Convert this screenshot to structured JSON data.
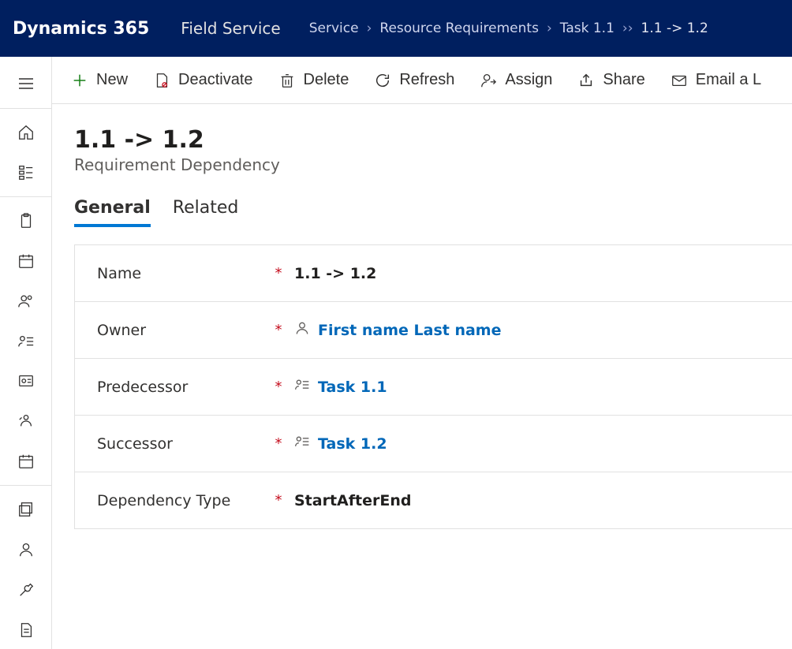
{
  "header": {
    "brand": "Dynamics 365",
    "app_title": "Field Service",
    "breadcrumb": {
      "area": "Service",
      "entity": "Resource Requirements",
      "parent": "Task 1.1",
      "current": "1.1 -> 1.2"
    }
  },
  "commands": {
    "new": "New",
    "deactivate": "Deactivate",
    "delete": "Delete",
    "refresh": "Refresh",
    "assign": "Assign",
    "share": "Share",
    "email_link": "Email a L"
  },
  "record": {
    "title": "1.1 -> 1.2",
    "subtitle": "Requirement Dependency"
  },
  "tabs": {
    "general": "General",
    "related": "Related"
  },
  "form": {
    "name": {
      "label": "Name",
      "value": "1.1 -> 1.2",
      "required": "*"
    },
    "owner": {
      "label": "Owner",
      "value": "First name Last name",
      "required": "*"
    },
    "predecessor": {
      "label": "Predecessor",
      "value": "Task 1.1",
      "required": "*"
    },
    "successor": {
      "label": "Successor",
      "value": "Task 1.2",
      "required": "*"
    },
    "dependency_type": {
      "label": "Dependency Type",
      "value": "StartAfterEnd",
      "required": "*"
    }
  }
}
